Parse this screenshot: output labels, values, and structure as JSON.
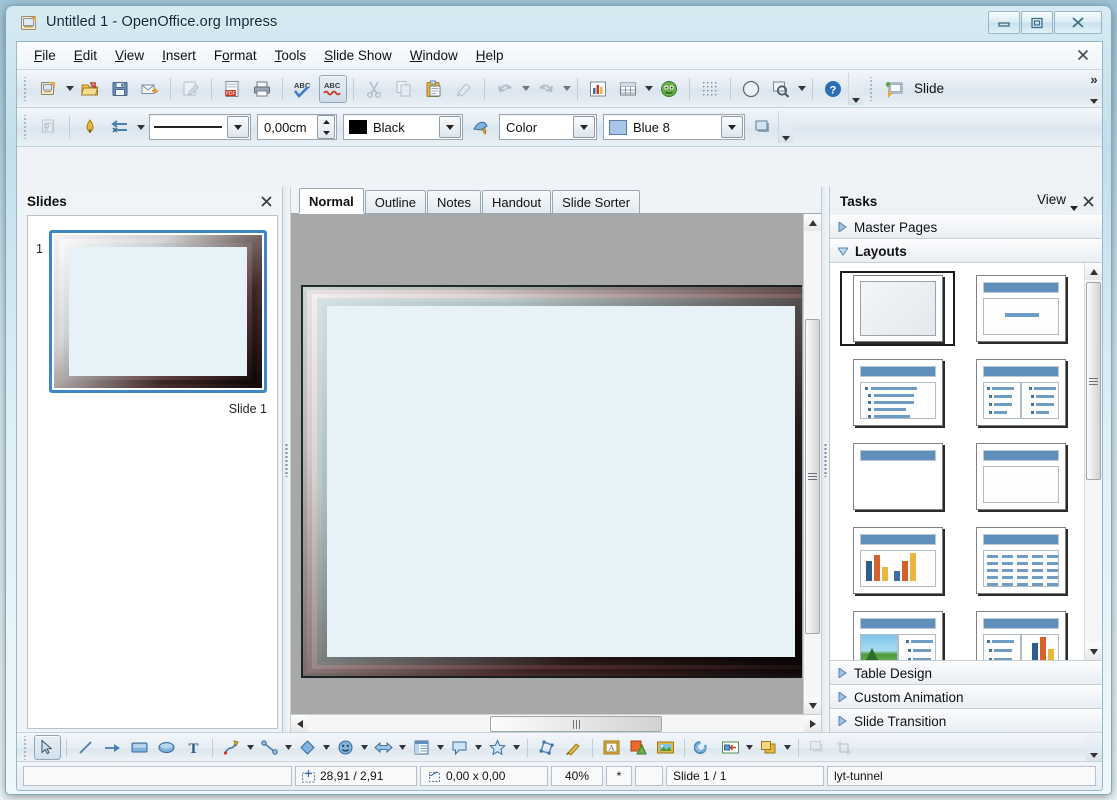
{
  "window": {
    "title": "Untitled 1 - OpenOffice.org Impress",
    "icon": "impress-document-icon",
    "buttons": {
      "minimize": "minimize-button",
      "maximize": "maximize-button",
      "close": "close-button"
    }
  },
  "menubar": {
    "items": [
      {
        "label": "File",
        "accel": "F"
      },
      {
        "label": "Edit",
        "accel": "E"
      },
      {
        "label": "View",
        "accel": "V"
      },
      {
        "label": "Insert",
        "accel": "I"
      },
      {
        "label": "Format",
        "accel": "o"
      },
      {
        "label": "Tools",
        "accel": "T"
      },
      {
        "label": "Slide Show",
        "accel": "S"
      },
      {
        "label": "Window",
        "accel": "W"
      },
      {
        "label": "Help",
        "accel": "H"
      }
    ],
    "close_doc": "close-document-icon"
  },
  "standard_toolbar": {
    "buttons": [
      "new-document-icon",
      "open-document-icon",
      "save-icon",
      "email-document-icon",
      "edit-file-icon",
      "export-pdf-icon",
      "print-icon",
      "spelling-icon",
      "autospellcheck-icon",
      "cut-icon",
      "copy-icon",
      "paste-icon",
      "clone-formatting-icon",
      "undo-icon",
      "redo-icon",
      "chart-icon",
      "table-icon",
      "gallery-icon",
      "display-grid-icon",
      "navigator-icon",
      "zoom-icon",
      "help-icon"
    ],
    "overflow": "toolbar-overflow-icon"
  },
  "presentation_toolbar": {
    "slide_label": "Slide",
    "slide_icon": "new-slide-icon",
    "chevron": "»"
  },
  "line_fill_toolbar": {
    "display_views_icon": "display-views-icon",
    "line_arrow_icon": "line-endings-icon",
    "arrow_style_icon": "arrow-style-icon",
    "line_style_value": "—————",
    "line_width_value": "0,00cm",
    "line_color_value": "Black",
    "area_style_icon": "area-style-icon",
    "fill_type_value": "Color",
    "fill_color_value": "Blue 8",
    "shadow_icon": "shadow-icon"
  },
  "slides_panel": {
    "title": "Slides",
    "close_icon": "close-panel-icon",
    "slides": [
      {
        "number": "1",
        "label": "Slide 1"
      }
    ]
  },
  "view_tabs": [
    {
      "label": "Normal",
      "selected": true
    },
    {
      "label": "Outline",
      "selected": false
    },
    {
      "label": "Notes",
      "selected": false
    },
    {
      "label": "Handout",
      "selected": false
    },
    {
      "label": "Slide Sorter",
      "selected": false
    }
  ],
  "tasks_panel": {
    "title": "Tasks",
    "view_label": "View",
    "view_dropdown_icon": "chevron-down-icon",
    "close_icon": "close-panel-icon",
    "sections": [
      {
        "label": "Master Pages",
        "expanded": false
      },
      {
        "label": "Layouts",
        "expanded": true
      },
      {
        "label": "Table Design",
        "expanded": false
      },
      {
        "label": "Custom Animation",
        "expanded": false
      },
      {
        "label": "Slide Transition",
        "expanded": false
      }
    ],
    "layouts": [
      {
        "name": "blank-slide",
        "selected": true
      },
      {
        "name": "title-slide",
        "selected": false
      },
      {
        "name": "title-content",
        "selected": false
      },
      {
        "name": "title-two-content",
        "selected": false
      },
      {
        "name": "title-only",
        "selected": false
      },
      {
        "name": "centered-text",
        "selected": false
      },
      {
        "name": "title-chart",
        "selected": false
      },
      {
        "name": "title-spreadsheet",
        "selected": false
      },
      {
        "name": "title-clipart-content",
        "selected": false
      },
      {
        "name": "title-content-chart",
        "selected": false
      }
    ]
  },
  "drawing_toolbar": {
    "buttons": [
      "select-icon",
      "line-icon",
      "line-ends-arrow-icon",
      "rectangle-icon",
      "ellipse-icon",
      "text-icon",
      "curve-icon",
      "connector-icon",
      "basic-shapes-icon",
      "symbol-shapes-icon",
      "block-arrows-icon",
      "flowchart-icon",
      "callouts-icon",
      "stars-icon",
      "points-icon",
      "glue-points-icon",
      "from-file-icon",
      "3d-objects-icon",
      "gallery-image-icon",
      "rotate-icon",
      "alignment-icon",
      "arrange-icon",
      "shadow-dim-icon",
      "crop-dim-icon"
    ],
    "overflow": "toolbar-overflow-icon"
  },
  "statusbar": {
    "info_text": "",
    "cursor_position": "28,91 / 2,91",
    "object_size": "0,00 x 0,00",
    "zoom": "40%",
    "modified": "*",
    "signature": "",
    "slide_counter": "Slide 1 / 1",
    "master_page": "lyt-tunnel",
    "position_icon": "cursor-position-icon",
    "size_icon": "object-size-icon"
  },
  "colors": {
    "slide_fill": "#e6f2f8",
    "canvas_bg": "#a8a8a8",
    "selection_blue": "#3f86c4",
    "title_gradient_top": "#d7eaf2"
  }
}
